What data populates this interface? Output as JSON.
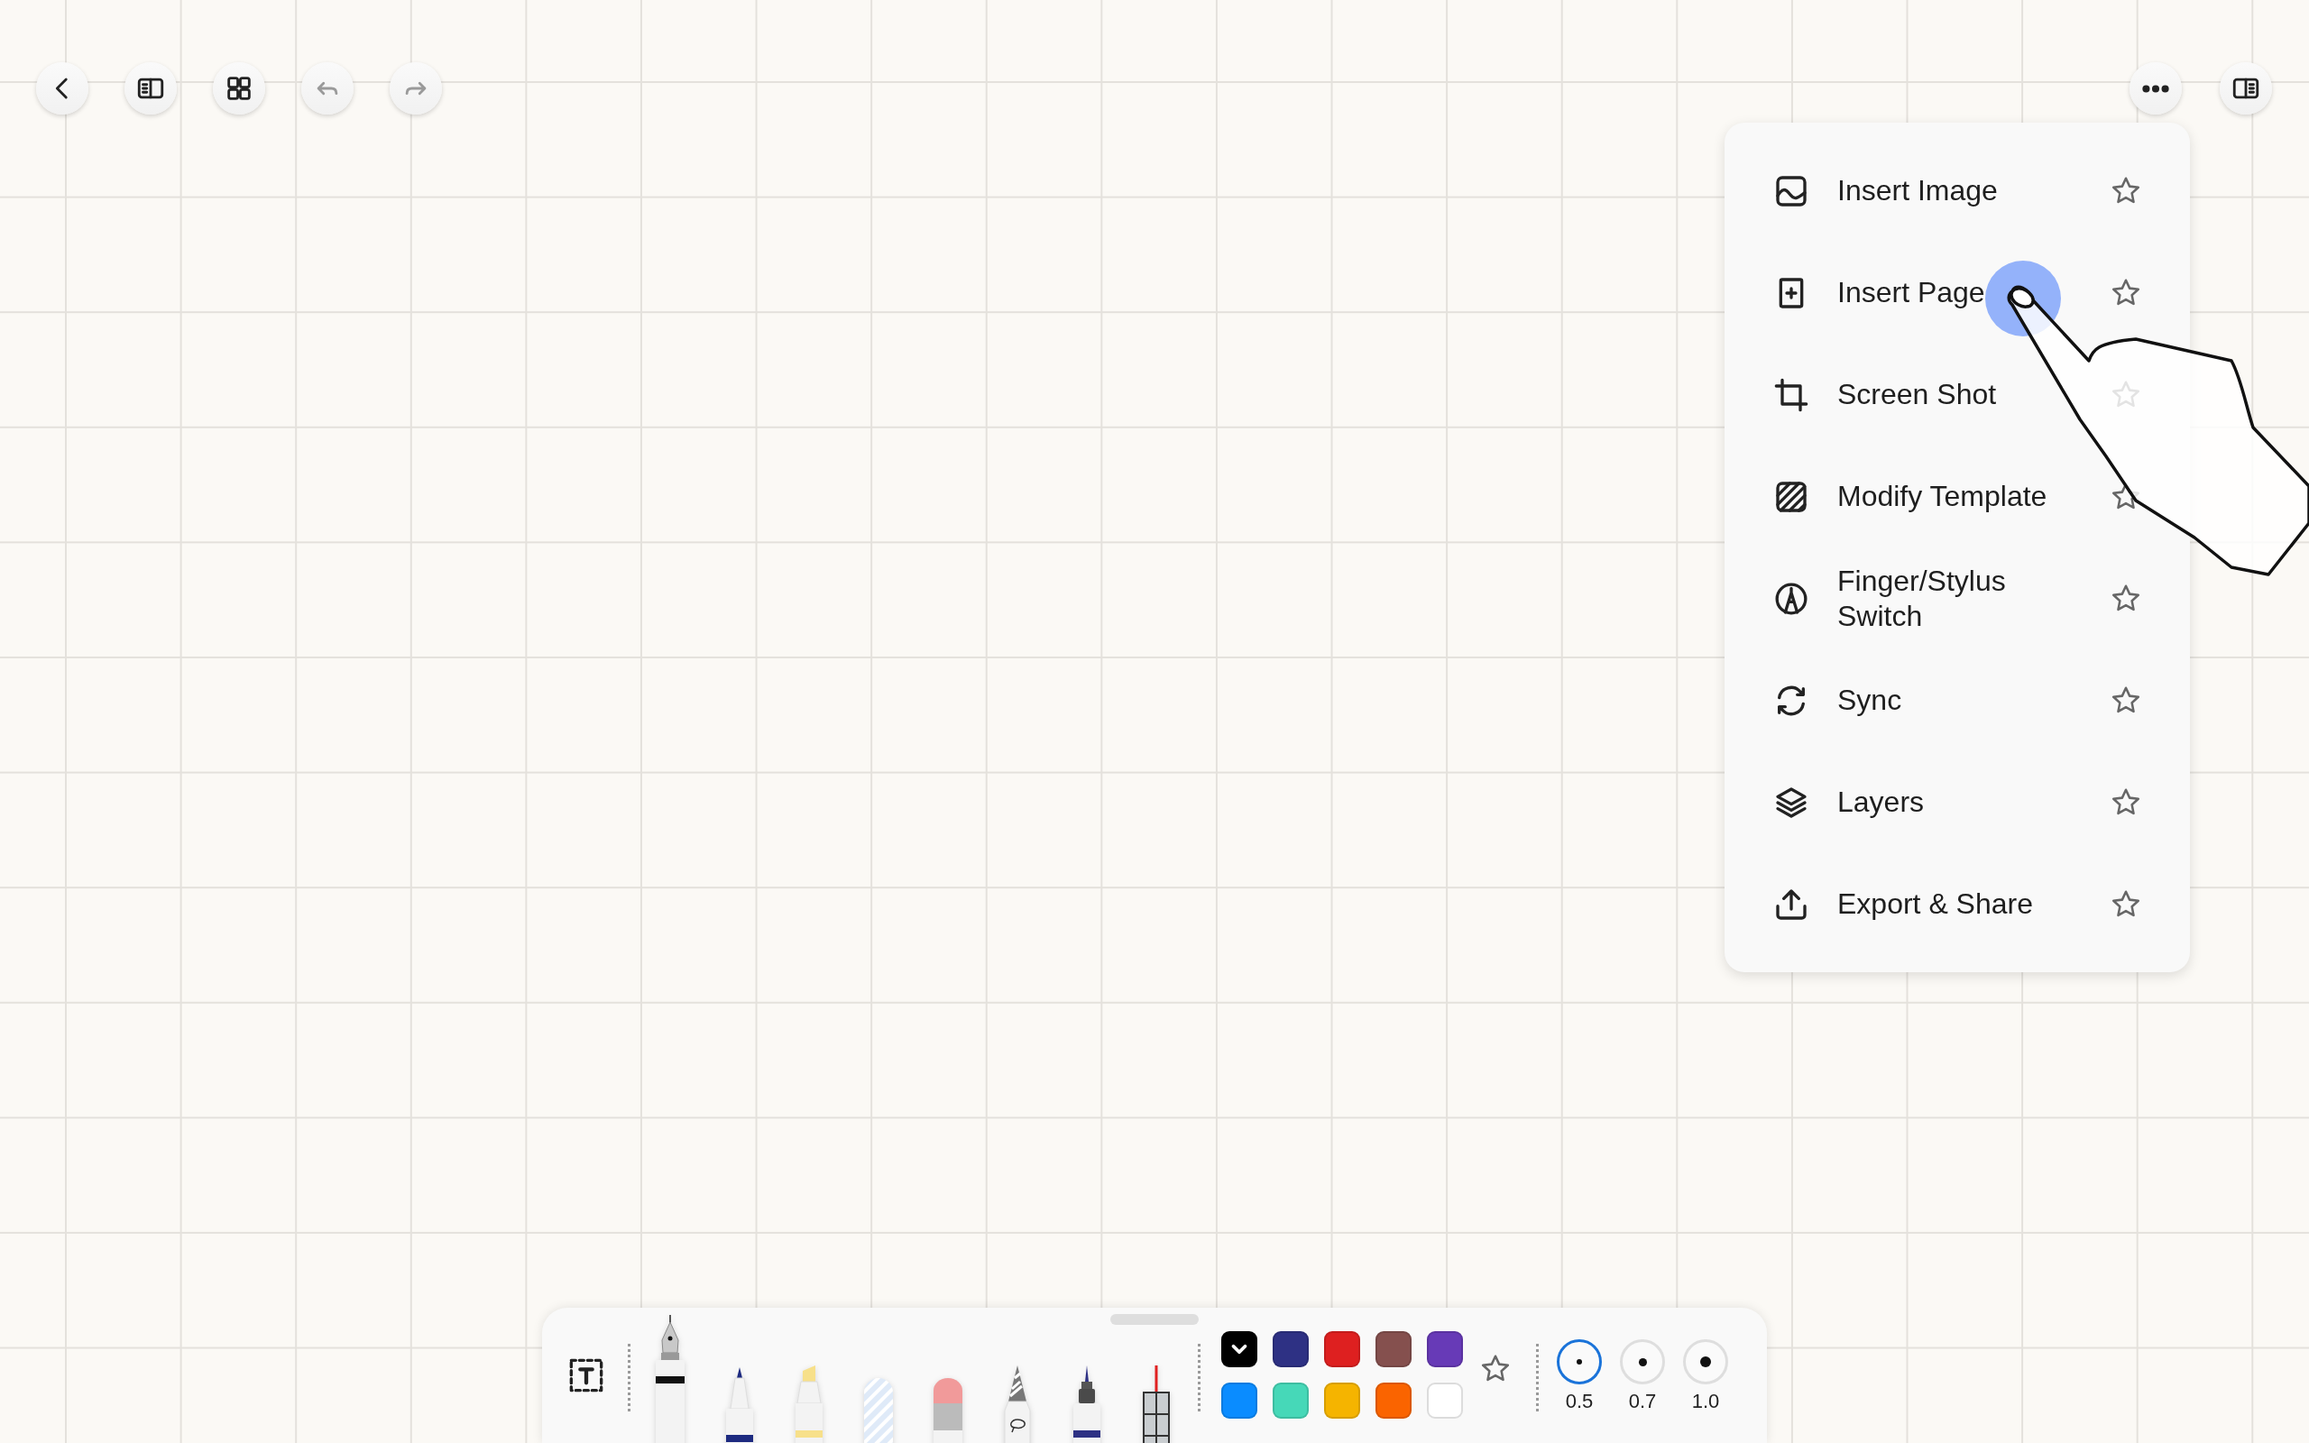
{
  "top_bar": {
    "left_buttons": [
      {
        "kind": "back",
        "disabled": false
      },
      {
        "kind": "sidebar",
        "disabled": false
      },
      {
        "kind": "grid",
        "disabled": false
      },
      {
        "kind": "undo",
        "disabled": true
      },
      {
        "kind": "redo",
        "disabled": true
      }
    ],
    "right_buttons": [
      {
        "kind": "more",
        "disabled": false
      },
      {
        "kind": "panel",
        "disabled": false
      }
    ]
  },
  "menu": {
    "items": [
      {
        "kind": "image",
        "label": "Insert Image",
        "starred": false
      },
      {
        "kind": "page",
        "label": "Insert Page",
        "starred": false
      },
      {
        "kind": "crop",
        "label": "Screen Shot",
        "starred": false
      },
      {
        "kind": "template",
        "label": "Modify Template",
        "starred": false
      },
      {
        "kind": "stylus",
        "label": "Finger/Stylus Switch",
        "starred": false
      },
      {
        "kind": "sync",
        "label": "Sync",
        "starred": false
      },
      {
        "kind": "layers",
        "label": "Layers",
        "starred": false
      },
      {
        "kind": "export",
        "label": "Export & Share",
        "starred": false
      }
    ]
  },
  "pen_toolbar": {
    "tools": [
      {
        "kind": "text",
        "selected": false
      },
      {
        "kind": "fountain",
        "selected": true
      },
      {
        "kind": "ballpoint",
        "selected": false
      },
      {
        "kind": "highlighter",
        "selected": false
      },
      {
        "kind": "tape",
        "selected": false
      },
      {
        "kind": "eraser",
        "selected": false
      },
      {
        "kind": "lasso",
        "selected": false
      },
      {
        "kind": "marker",
        "selected": false
      },
      {
        "kind": "ruler",
        "selected": false
      }
    ],
    "colors": [
      {
        "color": "#000000",
        "selected": true
      },
      {
        "color": "#2e3184",
        "selected": false
      },
      {
        "color": "#de2020",
        "selected": false
      },
      {
        "color": "#85504e",
        "selected": false
      },
      {
        "color": "#673ab7",
        "selected": false
      },
      {
        "color": "#0a8cff",
        "selected": false
      },
      {
        "color": "#46d8b8",
        "selected": false
      },
      {
        "color": "#f5b400",
        "selected": false
      },
      {
        "color": "#fa6400",
        "selected": false
      },
      {
        "color": "#ffffff",
        "selected": false
      }
    ],
    "favorite": {
      "starred": false
    },
    "sizes": [
      {
        "label": "0.5",
        "selected": true
      },
      {
        "label": "0.7",
        "selected": false
      },
      {
        "label": "1.0",
        "selected": false
      }
    ]
  }
}
